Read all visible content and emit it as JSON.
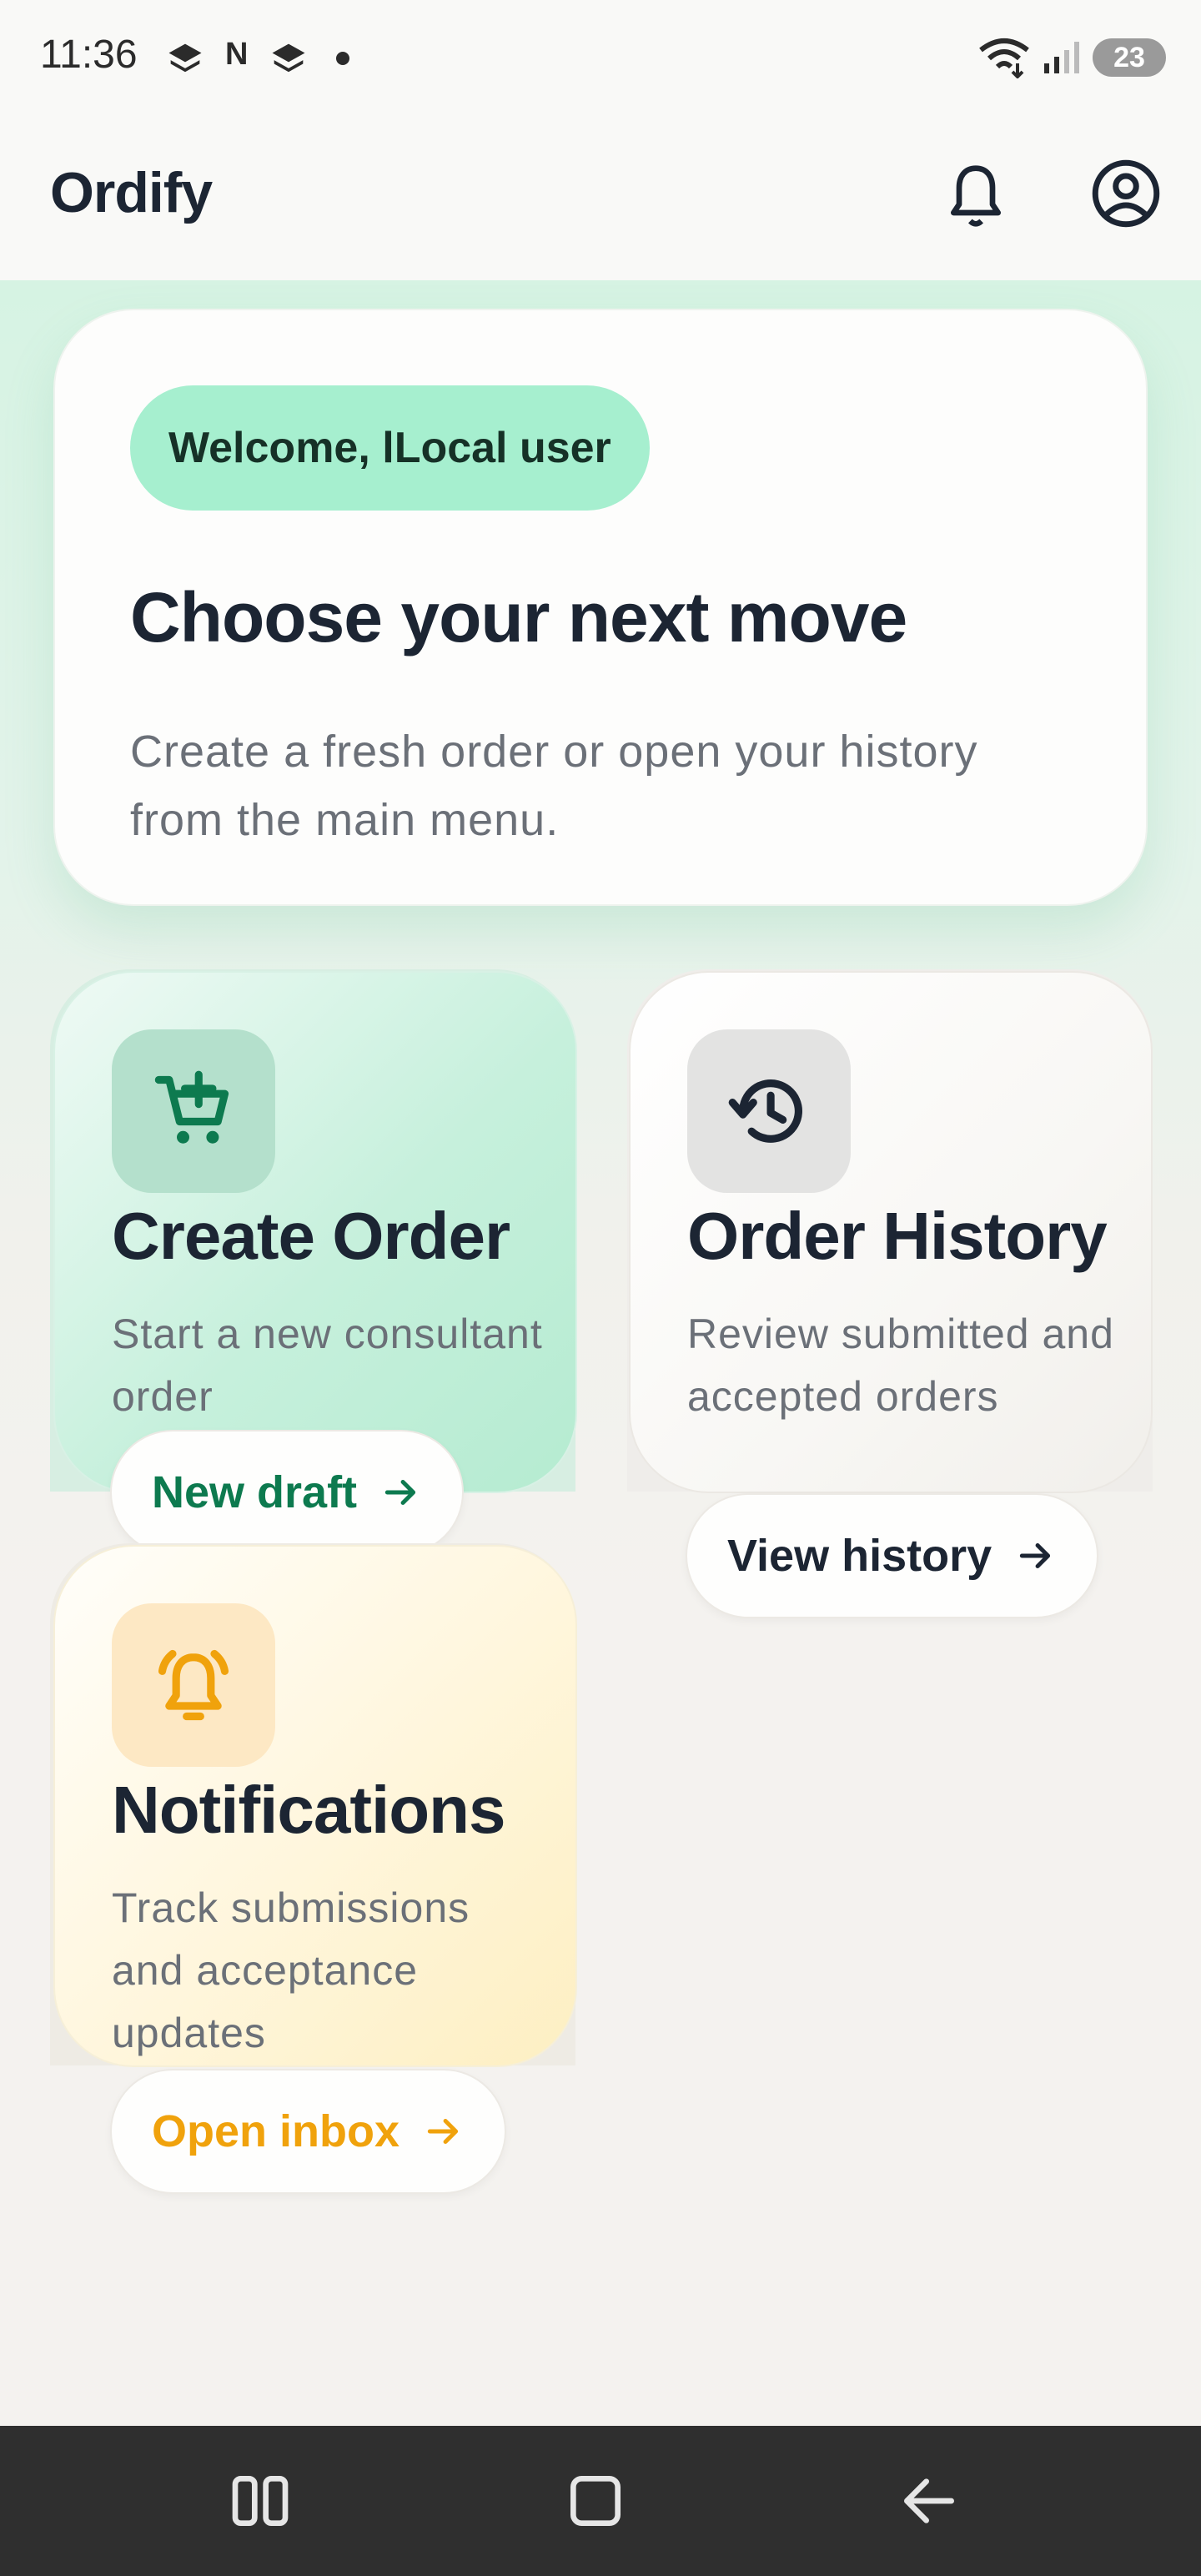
{
  "status_bar": {
    "time": "11:36",
    "notification_letter": "N",
    "battery": "23"
  },
  "app_bar": {
    "title": "Ordify",
    "icons": [
      "bell-icon",
      "account-circle-icon"
    ]
  },
  "hero": {
    "welcome": "Welcome, lLocal user",
    "title": "Choose your next move",
    "subtitle": "Create a fresh order or open your history from the main menu."
  },
  "cards": {
    "create_order": {
      "icon": "cart-add-icon",
      "title": "Create Order",
      "description": "Start a new consultant order",
      "action": "New draft",
      "accent": "#0d7a4f"
    },
    "order_history": {
      "icon": "history-icon",
      "title": "Order History",
      "description": "Review submitted and accepted orders",
      "action": "View history",
      "accent": "#1c2533"
    },
    "notifications": {
      "icon": "bell-alert-icon",
      "title": "Notifications",
      "description": "Track submissions and acceptance updates",
      "action": "Open inbox",
      "accent": "#f0a20c"
    }
  },
  "nav_bar": {
    "icons": [
      "recents-icon",
      "home-icon",
      "back-icon"
    ]
  },
  "colors": {
    "brand_green": "#0d7a4f",
    "welcome_chip": "#a6efcf",
    "amber": "#f0a20c",
    "text_dark": "#1c2533",
    "text_muted": "#6b7078"
  }
}
